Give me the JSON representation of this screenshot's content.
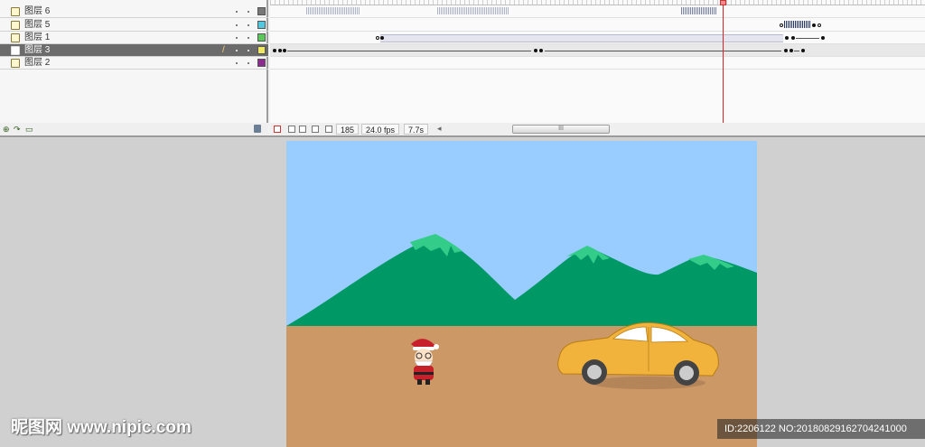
{
  "layers": [
    {
      "name": "图层 6",
      "color": "#777777",
      "active": false
    },
    {
      "name": "图层 5",
      "color": "#4fc8e0",
      "active": false
    },
    {
      "name": "图层 1",
      "color": "#59c95a",
      "active": false
    },
    {
      "name": "图层 3",
      "color": "#f0e860",
      "active": true
    },
    {
      "name": "图层 2",
      "color": "#8e2b8e",
      "active": false
    }
  ],
  "status": {
    "frame": "185",
    "fps": "24.0 fps",
    "time": "7.7s",
    "scroll_label": "III"
  },
  "watermark": {
    "logo": "昵图网 www.nipic.com",
    "id": "ID:2206122 NO:20180829162704241000"
  },
  "colors": {
    "sky": "#99ccff",
    "mountain": "#009966",
    "snow": "#33cc88",
    "ground": "#cc9966",
    "car": "#f2b33d"
  }
}
